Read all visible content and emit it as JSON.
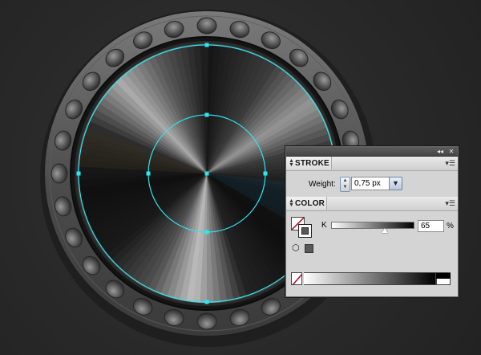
{
  "panel": {
    "topbar": {
      "collapse_label": "◂◂",
      "close_label": "✕"
    },
    "stroke": {
      "title": "STROKE",
      "weight_label": "Weight:",
      "weight_value": "0,75 px"
    },
    "color": {
      "title": "COLOR",
      "channel_label": "K",
      "channel_value": "65",
      "unit": "%",
      "slider_value_percent": 65,
      "current_stroke_color": "#595959"
    }
  },
  "colors": {
    "selection": "#2ee6f0",
    "background": "#2a2a2a",
    "panel_bg": "#d4d4d4"
  },
  "icons": [
    "double-arrow-icon",
    "close-icon",
    "panel-menu-icon",
    "stepper-icon",
    "dropdown-arrow-icon",
    "none-swatch-icon",
    "out-of-gamut-cube-icon"
  ]
}
